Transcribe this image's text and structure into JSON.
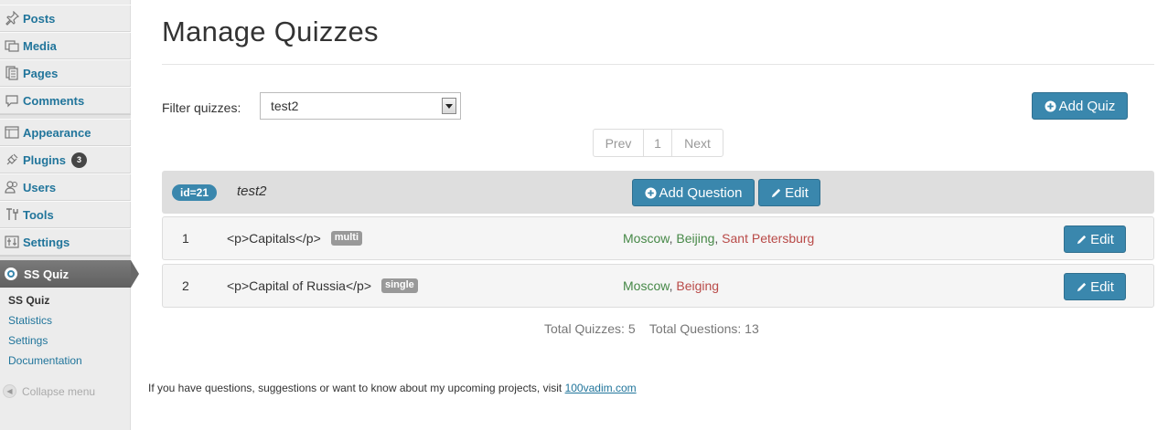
{
  "sidebar": {
    "items": [
      {
        "label": "Posts",
        "icon": "pushpin-icon"
      },
      {
        "label": "Media",
        "icon": "media-icon"
      },
      {
        "label": "Pages",
        "icon": "pages-icon"
      },
      {
        "label": "Comments",
        "icon": "comment-icon"
      },
      {
        "label": "Appearance",
        "icon": "appearance-icon"
      },
      {
        "label": "Plugins",
        "icon": "plugin-icon",
        "badge": "3"
      },
      {
        "label": "Users",
        "icon": "users-icon"
      },
      {
        "label": "Tools",
        "icon": "tools-icon"
      },
      {
        "label": "Settings",
        "icon": "settings-icon"
      }
    ],
    "current": {
      "label": "SS Quiz",
      "icon": "quiz-icon"
    },
    "submenu": [
      "SS Quiz",
      "Statistics",
      "Settings",
      "Documentation"
    ],
    "collapse_label": "Collapse menu"
  },
  "main": {
    "title": "Manage Quizzes",
    "filter": {
      "label": "Filter quizzes:",
      "selected": "test2"
    },
    "add_quiz_label": "Add Quiz",
    "pager": {
      "prev": "Prev",
      "page": "1",
      "next": "Next"
    },
    "quiz": {
      "id_badge": "id=21",
      "name": "test2",
      "add_question_label": "Add Question",
      "edit_label": "Edit"
    },
    "questions": [
      {
        "num": "1",
        "text": "<p>Capitals</p>",
        "type": "multi",
        "answers": [
          {
            "text": "Moscow",
            "correct": true
          },
          {
            "text": "Beijing",
            "correct": true
          },
          {
            "text": "Sant Petersburg",
            "correct": false
          }
        ],
        "edit_label": "Edit"
      },
      {
        "num": "2",
        "text": "<p>Capital of Russia</p>",
        "type": "single",
        "answers": [
          {
            "text": "Moscow",
            "correct": true
          },
          {
            "text": "Beiging",
            "correct": false
          }
        ],
        "edit_label": "Edit"
      }
    ],
    "totals": "Total Quizzes: 5    Total Questions: 13",
    "footer": {
      "text": "If you have questions, suggestions or want to know about my upcoming projects, visit ",
      "link": "100vadim.com"
    }
  },
  "colors": {
    "accent": "#3a87ad",
    "link": "#21759b",
    "correct": "#468847",
    "incorrect": "#b94a48"
  }
}
